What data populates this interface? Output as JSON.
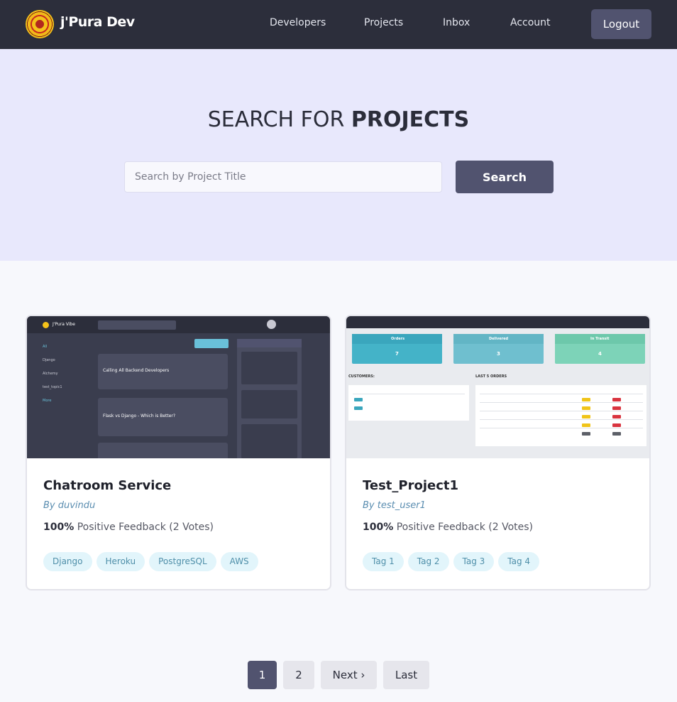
{
  "header": {
    "brand": "j'Pura Dev",
    "nav": [
      "Developers",
      "Projects",
      "Inbox",
      "Account"
    ],
    "logout": "Logout"
  },
  "hero": {
    "title_prefix": "SEARCH FOR ",
    "title_bold": "PROJECTS",
    "search_placeholder": "Search by Project Title",
    "search_button": "Search"
  },
  "projects": [
    {
      "title": "Chatroom Service",
      "author": "By duvindu",
      "feedback_pct": "100%",
      "feedback_text": " Positive Feedback (2 Votes)",
      "tags": [
        "Django",
        "Heroku",
        "PostgreSQL",
        "AWS"
      ],
      "thumbnail": {
        "brand": "J'Pura Vibe",
        "topics": [
          "All",
          "Django",
          "Alchemy",
          "test_topic1",
          "More"
        ],
        "rooms": [
          "Calling All Backend Developers",
          "Flask vs Django - Which is Better?"
        ]
      }
    },
    {
      "title": "Test_Project1",
      "author": "By test_user1",
      "feedback_pct": "100%",
      "feedback_text": " Positive Feedback (2 Votes)",
      "tags": [
        "Tag 1",
        "Tag 2",
        "Tag 3",
        "Tag 4"
      ],
      "thumbnail": {
        "stats": [
          {
            "label": "Orders",
            "value": "7"
          },
          {
            "label": "Delivered",
            "value": "3"
          },
          {
            "label": "In Transit",
            "value": "4"
          }
        ],
        "customers_label": "CUSTOMERS:",
        "orders_label": "LAST 5 ORDERS"
      }
    }
  ],
  "pagination": {
    "pages": [
      "1",
      "2"
    ],
    "next": "Next ›",
    "last": "Last"
  }
}
